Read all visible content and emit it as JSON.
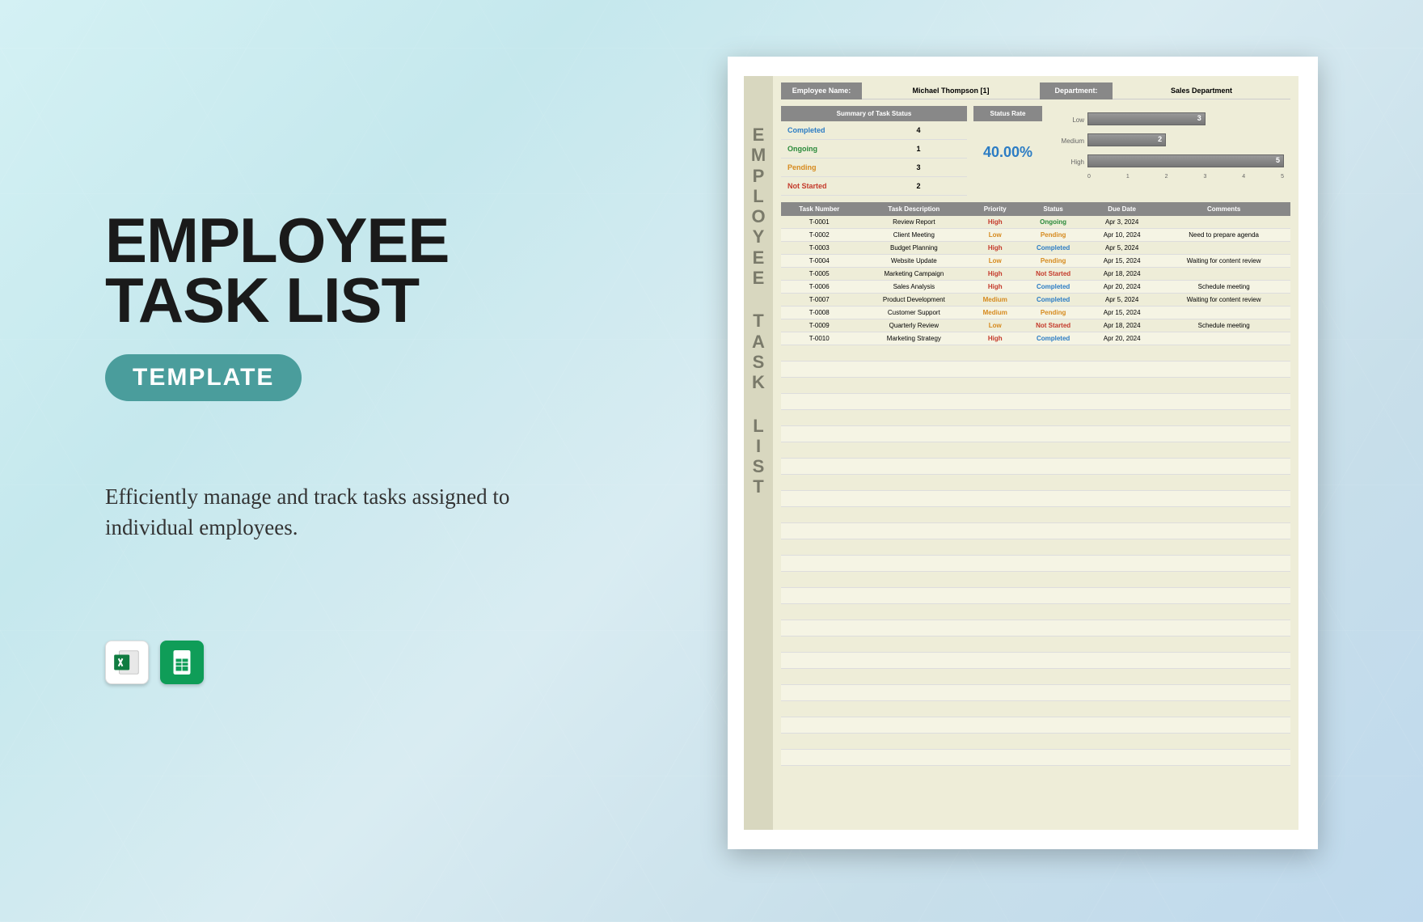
{
  "hero": {
    "title_l1": "EMPLOYEE",
    "title_l2": "TASK LIST",
    "badge": "TEMPLATE",
    "tagline": "Efficiently manage and track tasks assigned to individual employees."
  },
  "icons": {
    "excel": "excel-icon",
    "sheets": "google-sheets-icon"
  },
  "sheet": {
    "vertical_title": "EMPLOYEE TASK LIST",
    "header": {
      "emp_label": "Employee Name:",
      "emp_value": "Michael Thompson [1]",
      "dept_label": "Department:",
      "dept_value": "Sales Department"
    },
    "summary": {
      "title": "Summary of Task Status",
      "rows": [
        {
          "label": "Completed",
          "value": "4",
          "class": "c-completed"
        },
        {
          "label": "Ongoing",
          "value": "1",
          "class": "c-ongoing"
        },
        {
          "label": "Pending",
          "value": "3",
          "class": "c-pending"
        },
        {
          "label": "Not Started",
          "value": "2",
          "class": "c-notstarted"
        }
      ]
    },
    "rate": {
      "title": "Status Rate",
      "value": "40.00%"
    },
    "table": {
      "cols": [
        "Task Number",
        "Task Description",
        "Priority",
        "Status",
        "Due Date",
        "Comments"
      ],
      "rows": [
        {
          "num": "T-0001",
          "desc": "Review Report",
          "pri": "High",
          "priClass": "p-high",
          "stat": "Ongoing",
          "statClass": "c-ongoing",
          "due": "Apr 3, 2024",
          "comm": ""
        },
        {
          "num": "T-0002",
          "desc": "Client Meeting",
          "pri": "Low",
          "priClass": "p-low",
          "stat": "Pending",
          "statClass": "c-pending",
          "due": "Apr 10, 2024",
          "comm": "Need to prepare agenda"
        },
        {
          "num": "T-0003",
          "desc": "Budget Planning",
          "pri": "High",
          "priClass": "p-high",
          "stat": "Completed",
          "statClass": "c-completed",
          "due": "Apr 5, 2024",
          "comm": ""
        },
        {
          "num": "T-0004",
          "desc": "Website Update",
          "pri": "Low",
          "priClass": "p-low",
          "stat": "Pending",
          "statClass": "c-pending",
          "due": "Apr 15, 2024",
          "comm": "Waiting for content review"
        },
        {
          "num": "T-0005",
          "desc": "Marketing Campaign",
          "pri": "High",
          "priClass": "p-high",
          "stat": "Not Started",
          "statClass": "c-notstarted",
          "due": "Apr 18, 2024",
          "comm": ""
        },
        {
          "num": "T-0006",
          "desc": "Sales Analysis",
          "pri": "High",
          "priClass": "p-high",
          "stat": "Completed",
          "statClass": "c-completed",
          "due": "Apr 20, 2024",
          "comm": "Schedule meeting"
        },
        {
          "num": "T-0007",
          "desc": "Product Development",
          "pri": "Medium",
          "priClass": "p-medium",
          "stat": "Completed",
          "statClass": "c-completed",
          "due": "Apr 5, 2024",
          "comm": "Waiting for content review"
        },
        {
          "num": "T-0008",
          "desc": "Customer Support",
          "pri": "Medium",
          "priClass": "p-medium",
          "stat": "Pending",
          "statClass": "c-pending",
          "due": "Apr 15, 2024",
          "comm": ""
        },
        {
          "num": "T-0009",
          "desc": "Quarterly Review",
          "pri": "Low",
          "priClass": "p-low",
          "stat": "Not Started",
          "statClass": "c-notstarted",
          "due": "Apr 18, 2024",
          "comm": "Schedule meeting"
        },
        {
          "num": "T-0010",
          "desc": "Marketing Strategy",
          "pri": "High",
          "priClass": "p-high",
          "stat": "Completed",
          "statClass": "c-completed",
          "due": "Apr 20, 2024",
          "comm": ""
        }
      ]
    }
  },
  "chart_data": {
    "type": "bar",
    "orientation": "horizontal",
    "categories": [
      "Low",
      "Medium",
      "High"
    ],
    "values": [
      3,
      2,
      5
    ],
    "xlim": [
      0,
      5
    ],
    "ticks": [
      0,
      1,
      2,
      3,
      4,
      5
    ]
  }
}
